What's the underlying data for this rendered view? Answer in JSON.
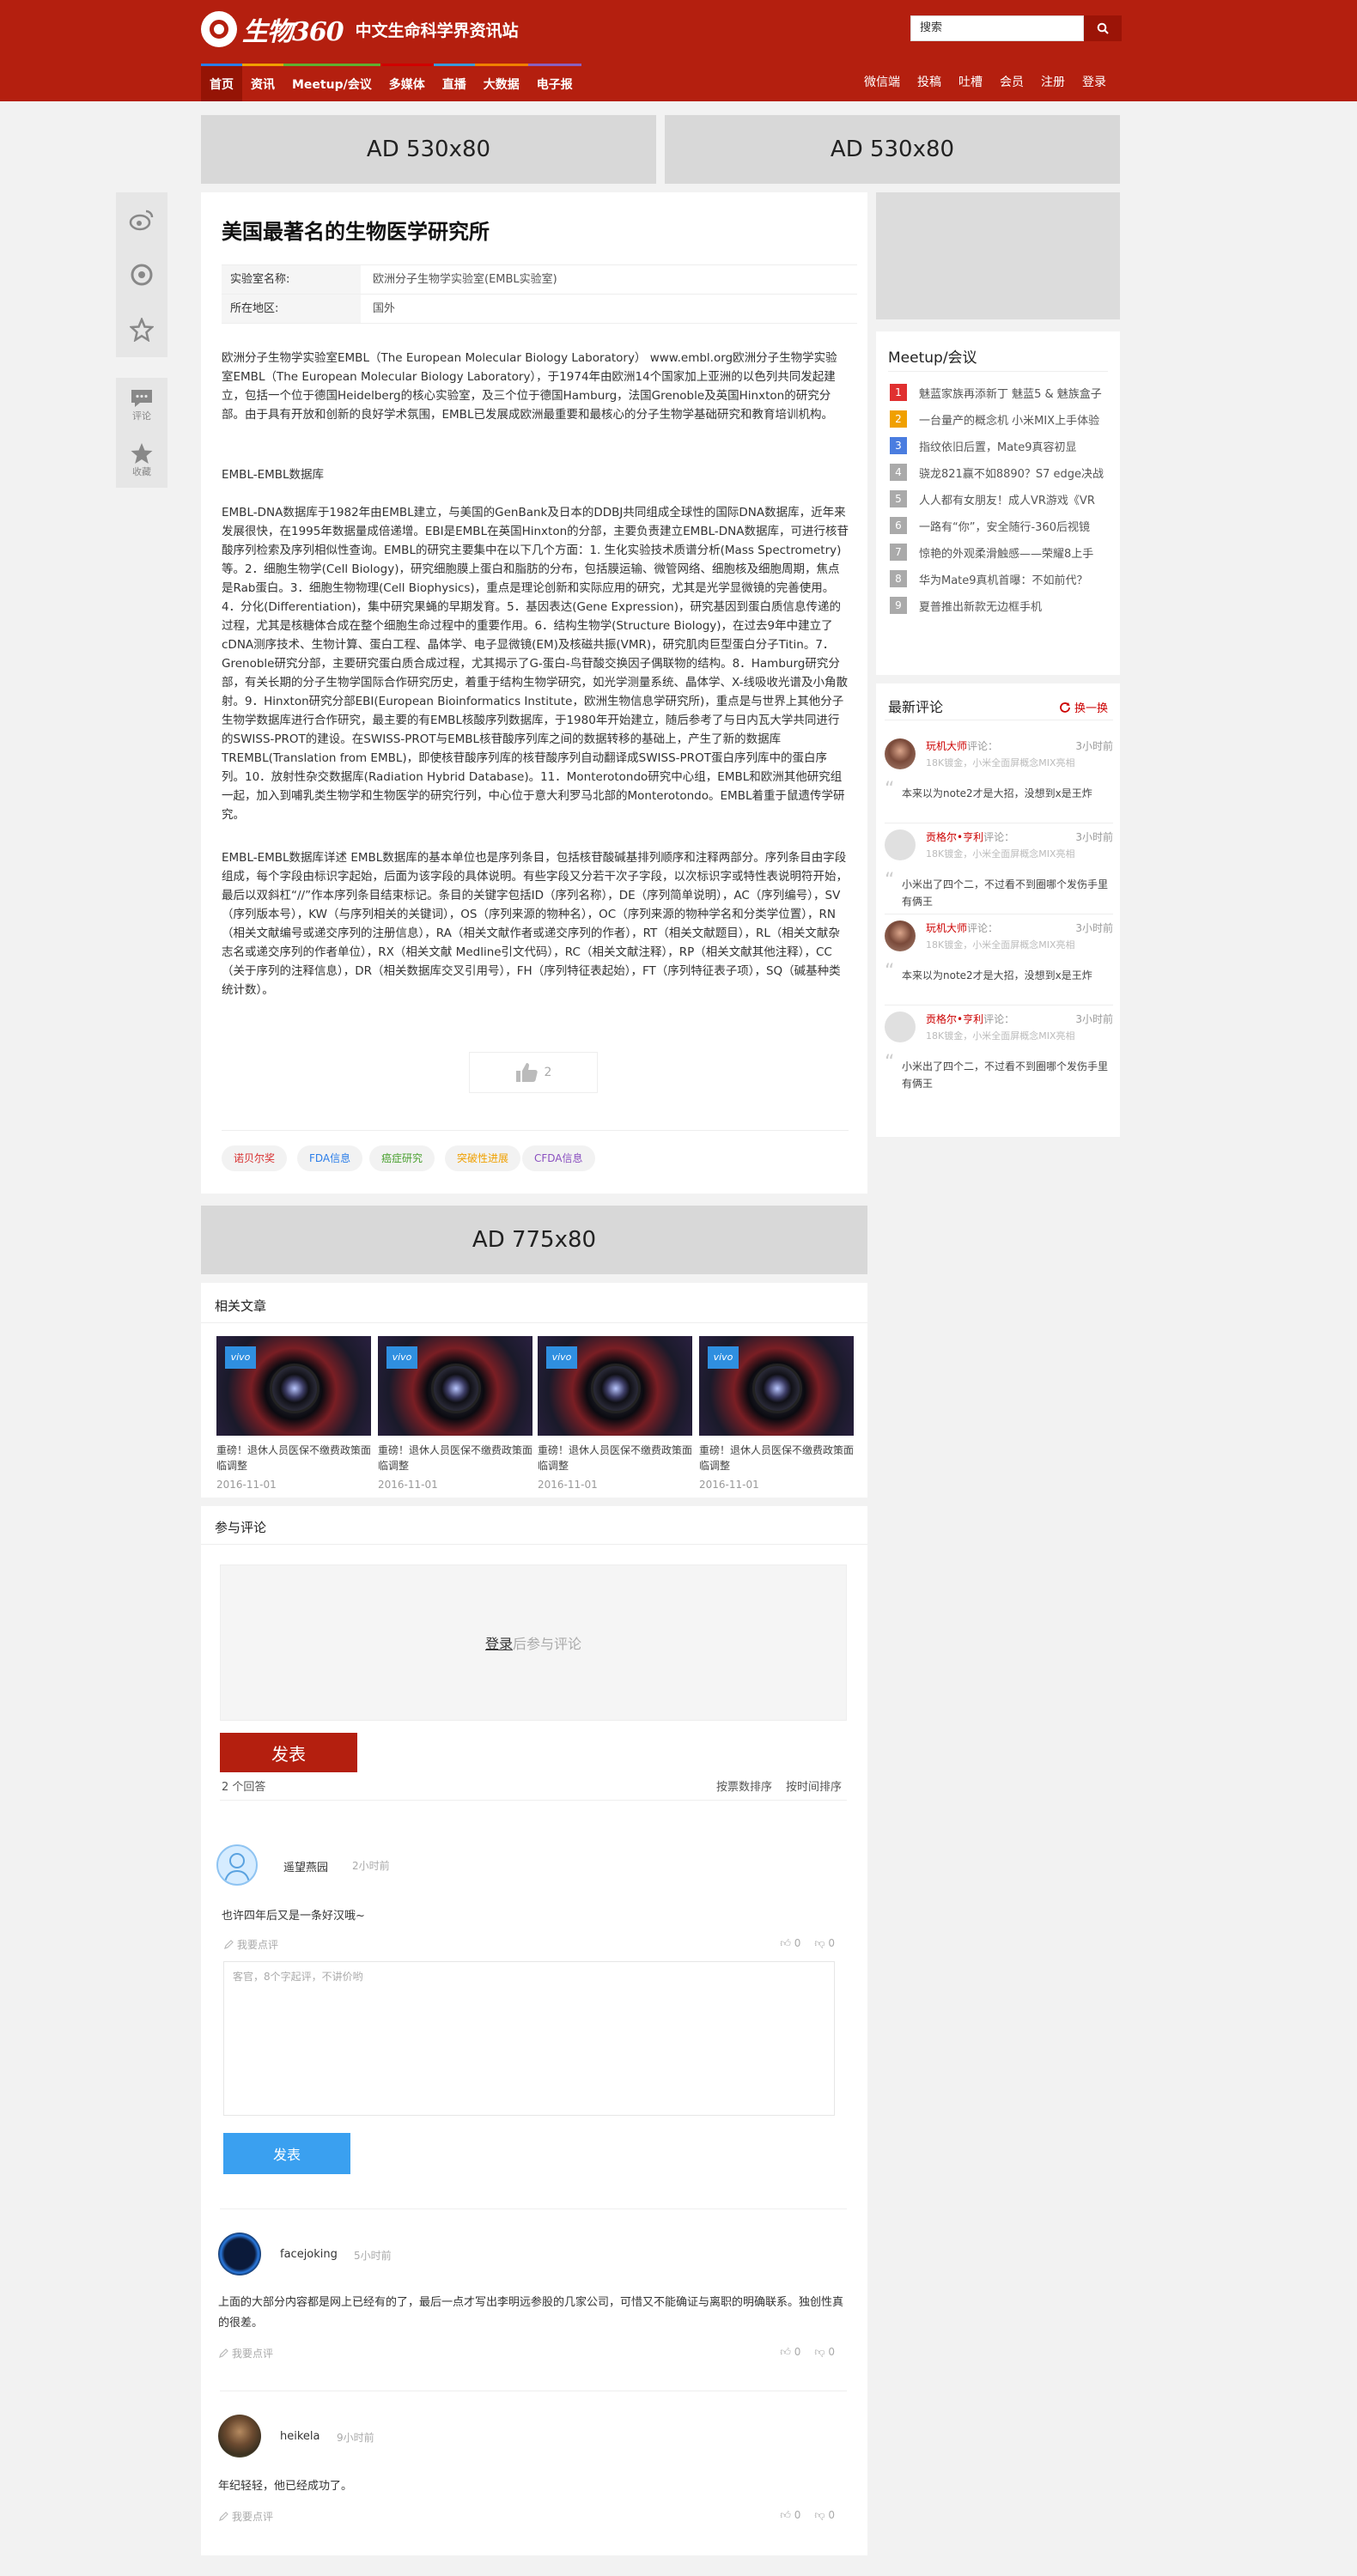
{
  "header": {
    "brand": "生物360",
    "slogan": "中文生命科学界资讯站",
    "search_placeholder": "搜索",
    "nav": [
      {
        "label": "首页",
        "color": "#2b7de9"
      },
      {
        "label": "资讯",
        "color": "#f0a000"
      },
      {
        "label": "Meetup/会议",
        "color": "#60b030"
      },
      {
        "label": "多媒体",
        "color": "#d00000"
      },
      {
        "label": "直播",
        "color": "#3a9ad9"
      },
      {
        "label": "大数据",
        "color": "#f08000"
      },
      {
        "label": "电子报",
        "color": "#8a60c0"
      }
    ],
    "right_nav": [
      "微信端",
      "投稿",
      "吐槽",
      "会员",
      "注册",
      "登录"
    ]
  },
  "ads": {
    "top_left": "AD 530x80",
    "top_right": "AD 530x80",
    "bottom": "AD 775x80"
  },
  "float_bar": {
    "comment": "评论",
    "favorite": "收藏"
  },
  "article": {
    "title": "美国最著名的生物医学研究所",
    "info": [
      {
        "key": "实验室名称:",
        "value": "欧洲分子生物学实验室(EMBL实验室)"
      },
      {
        "key": "所在地区:",
        "value": "国外"
      }
    ],
    "paragraphs": [
      "欧洲分子生物学实验室EMBL（The European Molecular Biology Laboratory） www.embl.org欧洲分子生物学实验室EMBL（The European Molecular Biology Laboratory），于1974年由欧洲14个国家加上亚洲的以色列共同发起建立，包括一个位于德国Heidelberg的核心实验室，及三个位于德国Hamburg，法国Grenoble及英国Hinxton的研究分部。由于具有开放和创新的良好学术氛围，EMBL已发展成欧洲最重要和最核心的分子生物学基础研究和教育培训机构。",
      "EMBL-EMBL数据库",
      "EMBL-DNA数据库于1982年由EMBL建立，与美国的GenBank及日本的DDBJ共同组成全球性的国际DNA数据库，近年来发展很快，在1995年数据量成倍递增。EBI是EMBL在英国Hinxton的分部，主要负责建立EMBL-DNA数据库，可进行核苷酸序列检索及序列相似性查询。EMBL的研究主要集中在以下几个方面：1. 生化实验技术质谱分析(Mass Spectrometry)等。2．细胞生物学(Cell Biology)，研究细胞膜上蛋白和脂肪的分布，包括膜运输、微管网络、细胞核及细胞周期，焦点是Rab蛋白。3．细胞生物物理(Cell Biophysics)，重点是理论创新和实际应用的研究，尤其是光学显微镜的完善使用。4．分化(Differentiation)，集中研究果蝇的早期发育。5．基因表达(Gene Expression)，研究基因到蛋白质信息传递的过程，尤其是核糖体合成在整个细胞生命过程中的重要作用。6．结构生物学(Structure Biology)，在过去9年中建立了cDNA测序技术、生物计算、蛋白工程、晶体学、电子显微镜(EM)及核磁共振(VMR)，研究肌肉巨型蛋白分子Titin。7．Grenoble研究分部，主要研究蛋白质合成过程，尤其揭示了G-蛋白-鸟苷酸交换因子偶联物的结构。8．Hamburg研究分部，有关长期的分子生物学国际合作研究历史，着重于结构生物学研究，如光学测量系统、晶体学、X-线吸收光谱及小角散射。9．Hinxton研究分部EBI(European Bioinformatics Institute，欧洲生物信息学研究所)，重点是与世界上其他分子生物学数据库进行合作研究，最主要的有EMBL核酸序列数据库，于1980年开始建立，随后参考了与日内瓦大学共同进行的SWISS-PROT的建设。在SWISS-PROT与EMBL核苷酸序列库之间的数据转移的基础上，产生了新的数据库TREMBL(Translation from EMBL)，即使核苷酸序列库的核苷酸序列自动翻译成SWISS-PROT蛋白序列库中的蛋白序列。10．放射性杂交数据库(Radiation Hybrid Database)。11．Monterotondo研究中心组，EMBL和欧洲其他研究组一起，加入到哺乳类生物学和生物医学的研究行列，中心位于意大利罗马北部的Monterotondo。EMBL着重于鼠遗传学研究。",
      "EMBL-EMBL数据库详述 EMBL数据库的基本单位也是序列条目，包括核苷酸碱基排列顺序和注释两部分。序列条目由字段组成，每个字段由标识字起始，后面为该字段的具体说明。有些字段又分若干次子字段，以次标识字或特性表说明符开始，最后以双斜杠“//”作本序列条目结束标记。条目的关键字包括ID（序列名称），DE（序列简单说明），AC（序列编号），SV（序列版本号），KW（与序列相关的关键词），OS（序列来源的物种名），OC（序列来源的物种学名和分类学位置），RN（相关文献编号或递交序列的注册信息），RA（相关文献作者或递交序列的作者），RT（相关文献题目），RL（相关文献杂志名或递交序列的作者单位），RX（相关文献  Medline引文代码），RC（相关文献注释），RP（相关文献其他注释），CC（关于序列的注释信息），DR（相关数据库交叉引用号），FH（序列特征表起始），FT（序列特征表子项），SQ（碱基种类统计数）。"
    ],
    "likes": "2",
    "tags": [
      {
        "label": "诺贝尔奖",
        "color": "#d83030"
      },
      {
        "label": "FDA信息",
        "color": "#2b7de9"
      },
      {
        "label": "癌症研究",
        "color": "#4aa030"
      },
      {
        "label": "突破性进展",
        "color": "#f0a000"
      },
      {
        "label": "CFDA信息",
        "color": "#8a50c0"
      }
    ]
  },
  "sidebar": {
    "meetup_title": "Meetup/会议",
    "hot": [
      {
        "num": "1",
        "text": "魅蓝家族再添新丁 魅蓝5 & 魅族盒子",
        "color": "#e03030"
      },
      {
        "num": "2",
        "text": "一台量产的概念机 小米MIX上手体验",
        "color": "#f0a000"
      },
      {
        "num": "3",
        "text": "指纹依旧后置，Mate9真容初显",
        "color": "#4a7de0"
      },
      {
        "num": "4",
        "text": "骁龙821赢不如8890？S7 edge决战",
        "color": "#aaa"
      },
      {
        "num": "5",
        "text": "人人都有女朋友！成人VR游戏《VR",
        "color": "#aaa"
      },
      {
        "num": "6",
        "text": "一路有“你”，安全随行-360后视镜",
        "color": "#aaa"
      },
      {
        "num": "7",
        "text": "惊艳的外观柔滑触感——荣耀8上手",
        "color": "#aaa"
      },
      {
        "num": "8",
        "text": "华为Mate9真机首曝：不如前代？",
        "color": "#aaa"
      },
      {
        "num": "9",
        "text": "夏普推出新款无边框手机",
        "color": "#aaa"
      }
    ],
    "latest_title": "最新评论",
    "refresh": "换一换",
    "comments": [
      {
        "name": "玩机大师",
        "action": "评论：",
        "time": "3小时前",
        "sub": "18K镀金，小米全面屏概念MIX亮相",
        "quote": "本来以为note2才是大招，没想到x是王炸"
      },
      {
        "name": "贡格尔•亨利",
        "action": "评论：",
        "time": "3小时前",
        "sub": "18K镀金，小米全面屏概念MIX亮相",
        "quote": "小米出了四个二，不过看不到圈哪个发伤手里有俩王"
      },
      {
        "name": "玩机大师",
        "action": "评论：",
        "time": "3小时前",
        "sub": "18K镀金，小米全面屏概念MIX亮相",
        "quote": "本来以为note2才是大招，没想到x是王炸"
      },
      {
        "name": "贡格尔•亨利",
        "action": "评论：",
        "time": "3小时前",
        "sub": "18K镀金，小米全面屏概念MIX亮相",
        "quote": "小米出了四个二，不过看不到圈哪个发伤手里有俩王"
      }
    ]
  },
  "related": {
    "title": "相关文章",
    "items": [
      {
        "badge": "vivo",
        "title": "重磅！退休人员医保不缴费政策面临调整",
        "date": "2016-11-01"
      },
      {
        "badge": "vivo",
        "title": "重磅！退休人员医保不缴费政策面临调整",
        "date": "2016-11-01"
      },
      {
        "badge": "vivo",
        "title": "重磅！退休人员医保不缴费政策面临调整",
        "date": "2016-11-01"
      },
      {
        "badge": "vivo",
        "title": "重磅！退休人员医保不缴费政策面临调整",
        "date": "2016-11-01"
      }
    ]
  },
  "discussion": {
    "title": "参与评论",
    "login": "登录",
    "login_rest": "后参与评论",
    "submit": "发表",
    "count": "2 个回答",
    "sort_votes": "按票数排序",
    "sort_time": "按时间排序",
    "reply_placeholder": "客官，8个字起评，不讲价哟",
    "reply_submit": "发表",
    "comments": [
      {
        "user": "遥望燕园",
        "time": "2小时前",
        "text": "也许四年后又是一条好汉哦~",
        "reply": "我要点评",
        "up": "0",
        "down": "0"
      },
      {
        "user": "facejoking",
        "time": "5小时前",
        "text": "上面的大部分内容都是网上已经有的了，最后一点才写出李明远参股的几家公司，可惜又不能确证与离职的明确联系。独创性真的很差。",
        "reply": "我要点评",
        "up": "0",
        "down": "0"
      },
      {
        "user": "heikela",
        "time": "9小时前",
        "text": "年纪轻轻，他已经成功了。",
        "reply": "我要点评",
        "up": "0",
        "down": "0"
      }
    ]
  }
}
